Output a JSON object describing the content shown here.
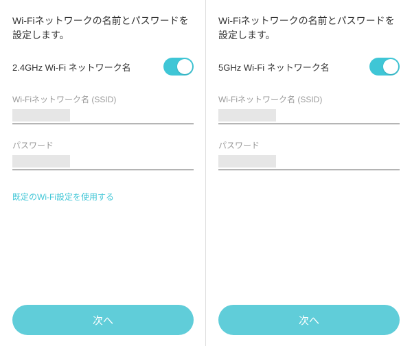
{
  "panes": [
    {
      "title": "Wi-Fiネットワークの名前とパスワードを設定します。",
      "band_label": "2.4GHz Wi-Fi ネットワーク名",
      "ssid_label": "Wi-Fiネットワーク名 (SSID)",
      "password_label": "パスワード",
      "use_default_link": "既定のWi-Fi設定を使用する",
      "next_label": "次へ",
      "show_link": true
    },
    {
      "title": "Wi-Fiネットワークの名前とパスワードを設定します。",
      "band_label": "5GHz Wi-Fi ネットワーク名",
      "ssid_label": "Wi-Fiネットワーク名 (SSID)",
      "password_label": "パスワード",
      "use_default_link": "",
      "next_label": "次へ",
      "show_link": false
    }
  ]
}
